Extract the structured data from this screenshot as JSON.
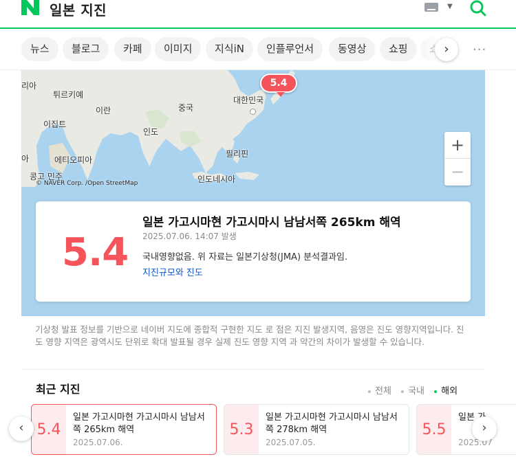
{
  "header": {
    "logo": "N",
    "query": "일본 지진",
    "icons": {
      "keyboard": "keyboard-icon",
      "search": "search-icon"
    },
    "accent": "#03c75a"
  },
  "tabs": {
    "items": [
      "뉴스",
      "블로그",
      "카페",
      "이미지",
      "지식iN",
      "인플루언서",
      "동영상",
      "쇼핑",
      "쇼"
    ],
    "next": "›",
    "more": "···"
  },
  "map": {
    "labels": {
      "turkey": "튀르키예",
      "iran": "이란",
      "china": "중국",
      "korea": "대한민국",
      "egypt": "이집트",
      "india": "인도",
      "ethiopia": "에티오피아",
      "philippines": "필리핀",
      "indonesia": "인도네시아",
      "congo": "콩고 민주",
      "left_top": "리아",
      "left_mid": "아"
    },
    "credit": "© NAVER Corp. /Open StreetMap",
    "marker": "5.4",
    "zoom_in": "+",
    "zoom_out": "−",
    "colors": {
      "water": "#a9d3ef",
      "land": "#eaeae4",
      "marker": "#f4545a"
    }
  },
  "main_quake": {
    "magnitude": "5.4",
    "title": "일본 가고시마현 가고시마시 남남서쪽 265km 해역",
    "date": "2025.07.06. 14:07 발생",
    "note": "국내영향없음. 위 자료는 일본기상청(JMA) 분석결과임.",
    "link": "지진규모와 진도"
  },
  "description": "기상청 발표 정보를 기반으로 네이버 지도에 종합적 구현한 지도 로 점은 지진 발생지역, 음영은 진도 영향지역입니다. 진도 영향 지역은 광역시도 단위로 확대 발표될 경우 실제 진도 영향 지역 과 약간의 차이가 발생할 수 있습니다.",
  "recent": {
    "heading": "최근 지진",
    "filters": [
      "전체",
      "국내",
      "해외"
    ],
    "active_filter": "해외",
    "items": [
      {
        "magnitude": "5.4",
        "title": "일본 가고시마현 가고시마시 남남서쪽 265km 해역",
        "date": "2025.07.06."
      },
      {
        "magnitude": "5.3",
        "title": "일본 가고시마현 가고시마시 남남서쪽 278km 해역",
        "date": "2025.07.05."
      },
      {
        "magnitude": "5.5",
        "title": "일본 가",
        "date": "2025.07"
      }
    ],
    "prev": "‹",
    "next": "›"
  }
}
